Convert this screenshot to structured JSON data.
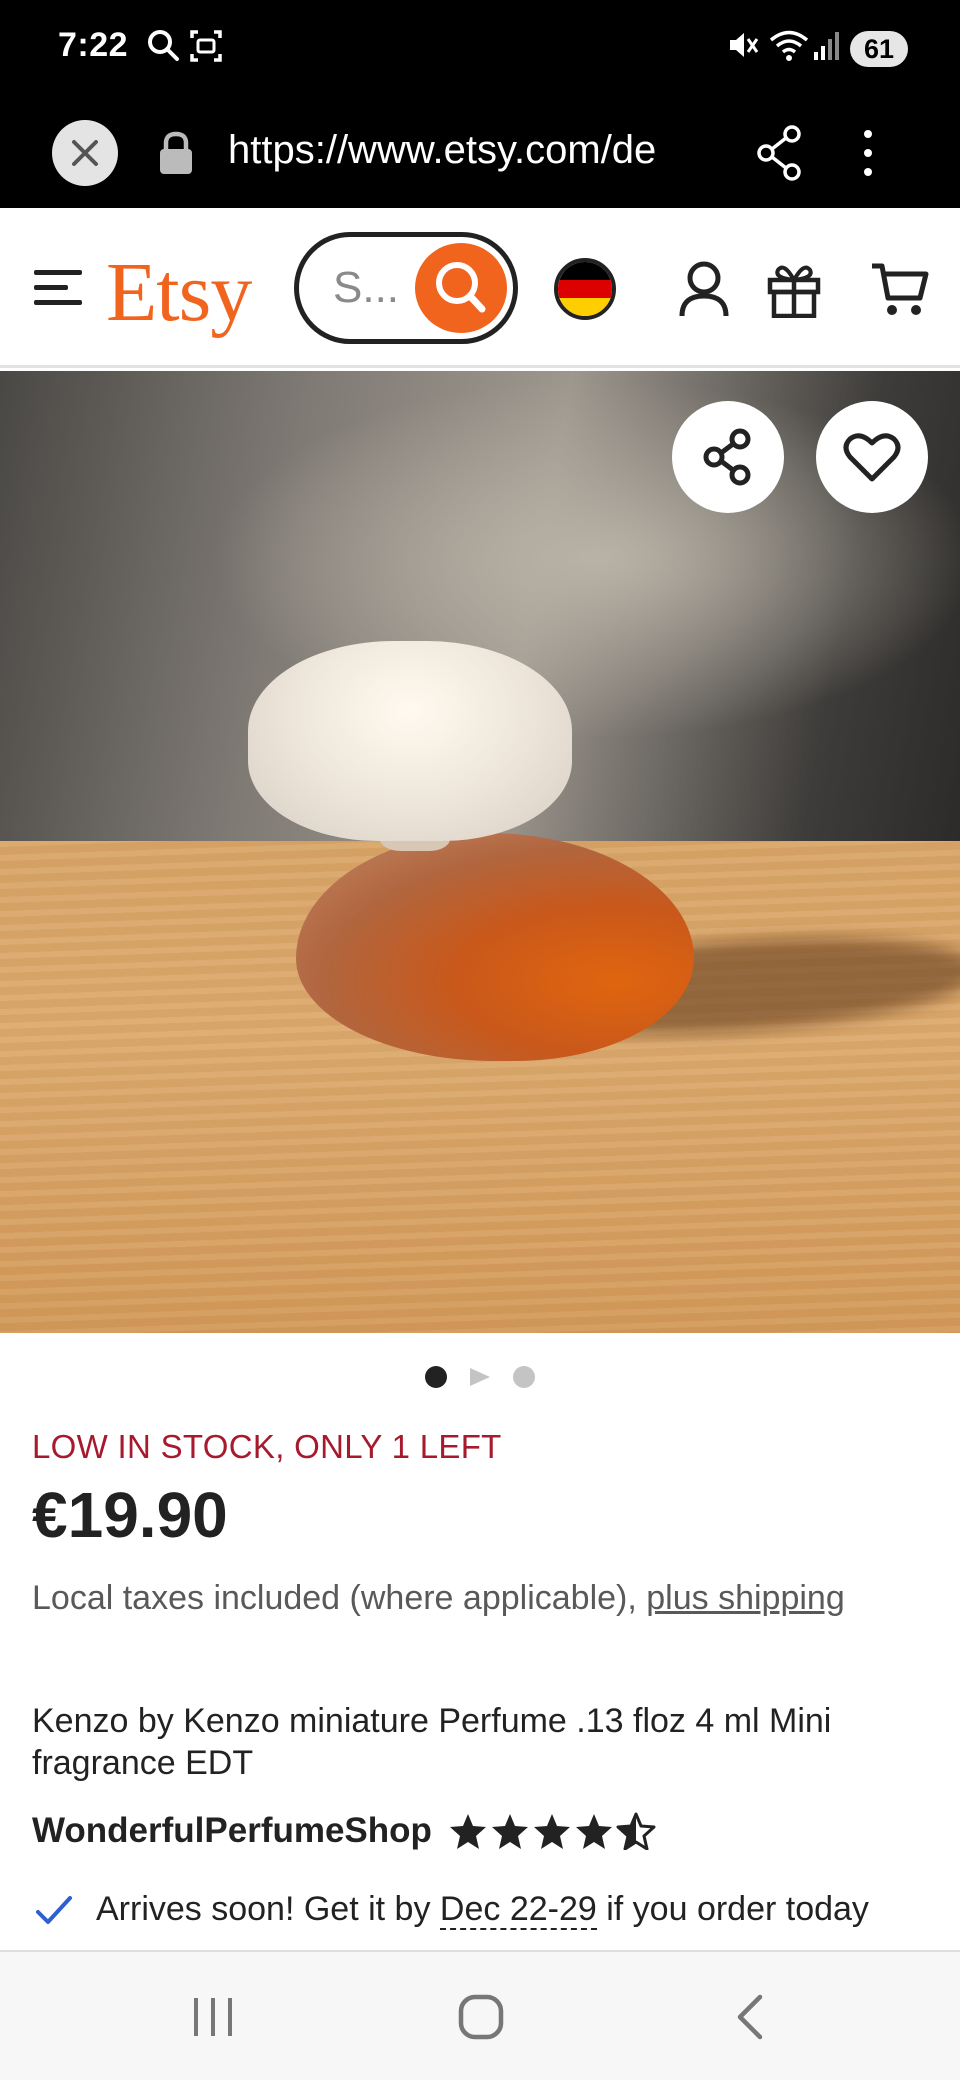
{
  "status_bar": {
    "time": "7:22",
    "battery": "61",
    "icons": [
      "search-icon",
      "screenshot-icon",
      "mute-icon",
      "wifi-icon",
      "signal-icon"
    ]
  },
  "browser": {
    "url": "https://www.etsy.com/de",
    "icons": [
      "close-icon",
      "lock-icon",
      "share-icon",
      "more-icon"
    ]
  },
  "header": {
    "logo": "Etsy",
    "search_placeholder": "S...",
    "icons": [
      "menu-icon",
      "search-icon",
      "germany-flag-icon",
      "account-icon",
      "gift-icon",
      "cart-icon"
    ]
  },
  "gallery": {
    "image_alt": "Kenzo perfume bottle with rose cap on wooden table",
    "slide_count": 3,
    "active_slide": 1,
    "icons": [
      "share-icon",
      "heart-icon"
    ]
  },
  "product": {
    "stock": "LOW IN STOCK, ONLY 1 LEFT",
    "price": "€19.90",
    "taxes_text": "Local taxes included (where applicable), ",
    "taxes_link": "plus shipping",
    "title": "Kenzo by Kenzo miniature Perfume .13 floz 4 ml Mini fragrance EDT",
    "shop_name": "WonderfulPerfumeShop",
    "rating": 4.5,
    "arrival_prefix": "Arrives soon! Get it by ",
    "arrival_date": "Dec 22-29",
    "arrival_suffix": " if you order today"
  },
  "nav_bar": {
    "icons": [
      "recent-apps-icon",
      "home-icon",
      "back-icon"
    ]
  },
  "colors": {
    "brand": "#f1641e",
    "stock": "#a61a2e"
  }
}
